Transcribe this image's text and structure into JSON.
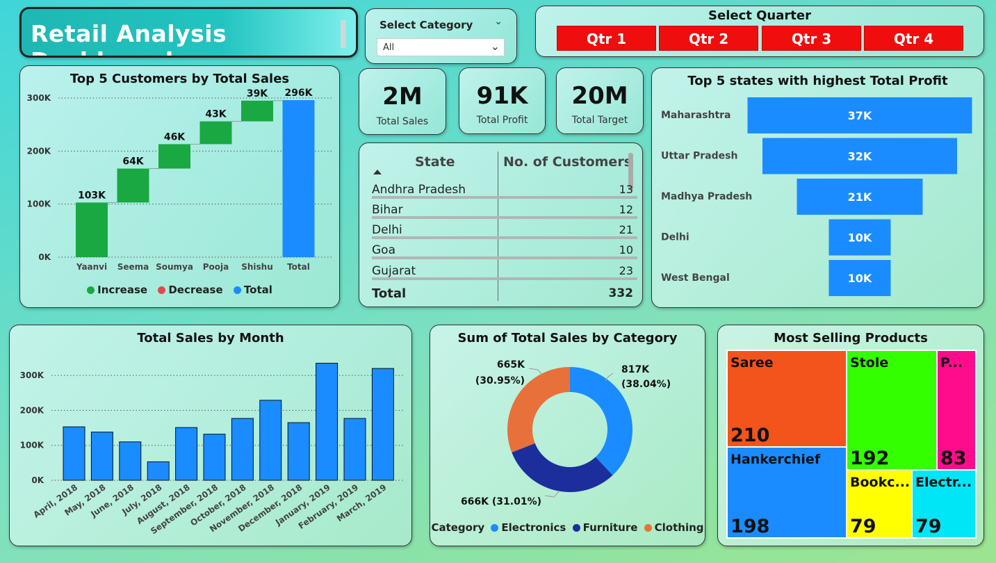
{
  "title": "Retail Analysis Dashboard",
  "category_slicer": {
    "label": "Select Category",
    "value": "All"
  },
  "quarter_slicer": {
    "label": "Select Quarter",
    "options": [
      "Qtr 1",
      "Qtr 2",
      "Qtr 3",
      "Qtr 4"
    ],
    "color": "#f00d0d"
  },
  "kpis": [
    {
      "value": "2M",
      "label": "Total Sales"
    },
    {
      "value": "91K",
      "label": "Total Profit"
    },
    {
      "value": "20M",
      "label": "Total Target"
    }
  ],
  "customers_table": {
    "headers": [
      "State",
      "No. of Customers"
    ],
    "rows": [
      {
        "state": "Andhra Pradesh",
        "count": "13"
      },
      {
        "state": "Bihar",
        "count": "12"
      },
      {
        "state": "Delhi",
        "count": "21"
      },
      {
        "state": "Goa",
        "count": "10"
      },
      {
        "state": "Gujarat",
        "count": "23"
      }
    ],
    "total_label": "Total",
    "total_value": "332"
  },
  "legend_waterfall": {
    "increase": "Increase",
    "decrease": "Decrease",
    "total": "Total"
  },
  "legend_donut": {
    "title": "Category",
    "items": [
      "Electronics",
      "Furniture",
      "Clothing"
    ]
  },
  "colors": {
    "increase": "#1aa843",
    "decrease": "#e04a4a",
    "total": "#1a8cff",
    "bar": "#1a8cff",
    "electronics": "#1a8cff",
    "furniture": "#1c2e9c",
    "clothing": "#e8703a"
  },
  "chart_data": [
    {
      "id": "waterfall",
      "type": "bar",
      "subtype": "waterfall",
      "title": "Top 5 Customers by Total Sales",
      "categories": [
        "Yaanvi",
        "Seema",
        "Soumya",
        "Pooja",
        "Shishu",
        "Total"
      ],
      "values": [
        103000,
        64000,
        46000,
        43000,
        39000,
        296000
      ],
      "labels": [
        "103K",
        "64K",
        "46K",
        "43K",
        "39K",
        "296K"
      ],
      "kinds": [
        "increase",
        "increase",
        "increase",
        "increase",
        "increase",
        "total"
      ],
      "ylim": [
        0,
        300000
      ],
      "yticks": [
        "0K",
        "100K",
        "200K",
        "300K"
      ],
      "grid": true,
      "legend": "bottom"
    },
    {
      "id": "funnel",
      "type": "bar",
      "subtype": "funnel",
      "title": "Top 5 states with highest Total Profit",
      "categories": [
        "Maharashtra",
        "Uttar Pradesh",
        "Madhya Pradesh",
        "Delhi",
        "West Bengal"
      ],
      "values": [
        37000,
        32000,
        21000,
        10000,
        10000
      ],
      "labels": [
        "37K",
        "32K",
        "21K",
        "10K",
        "10K"
      ]
    },
    {
      "id": "monthly",
      "type": "bar",
      "title": "Total Sales by Month",
      "categories": [
        "April, 2018",
        "May, 2018",
        "June, 2018",
        "July, 2018",
        "August, 2018",
        "September, 2018",
        "October, 2018",
        "November, 2018",
        "December, 2018",
        "January, 2019",
        "February, 2019",
        "March, 2019"
      ],
      "values": [
        153000,
        138000,
        110000,
        53000,
        151000,
        132000,
        177000,
        229000,
        165000,
        335000,
        177000,
        320000
      ],
      "ylim": [
        0,
        350000
      ],
      "yticks": [
        "0K",
        "100K",
        "200K",
        "300K"
      ],
      "grid": true
    },
    {
      "id": "donut",
      "type": "pie",
      "subtype": "donut",
      "title": "Sum of Total Sales by Category",
      "categories": [
        "Electronics",
        "Furniture",
        "Clothing"
      ],
      "values": [
        817000,
        666000,
        665000
      ],
      "labels": [
        "817K (38.04%)",
        "666K (31.01%)",
        "665K (30.95%)"
      ],
      "legend": "bottom"
    },
    {
      "id": "treemap",
      "type": "heatmap",
      "subtype": "treemap",
      "title": "Most Selling Products",
      "categories": [
        "Saree",
        "Hankerchief",
        "Stole",
        "P...",
        "Bookc...",
        "Electr..."
      ],
      "values": [
        210,
        198,
        192,
        83,
        79,
        79
      ]
    }
  ]
}
